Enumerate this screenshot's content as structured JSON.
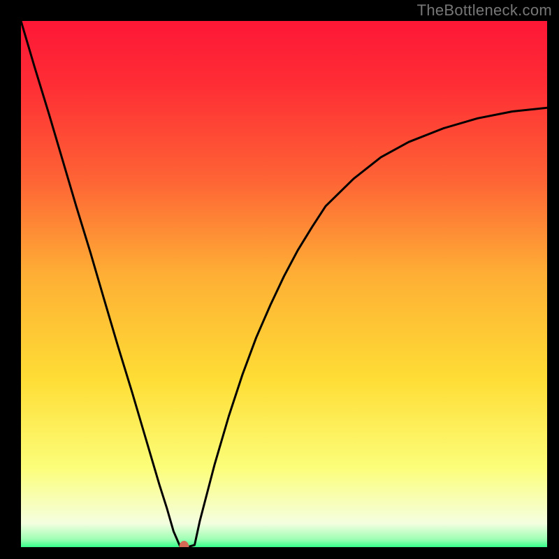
{
  "watermark": "TheBottleneck.com",
  "chart_data": {
    "type": "line",
    "title": "",
    "xlabel": "",
    "ylabel": "",
    "xlim": [
      0,
      100
    ],
    "ylim": [
      0,
      100
    ],
    "background_gradient": {
      "top": "#fe1736",
      "upper_mid": "#fe7b35",
      "mid": "#fedd35",
      "lower_mid": "#fbfeb4",
      "bottom": "#35fe8a"
    },
    "series": [
      {
        "name": "bottleneck-curve",
        "color": "#000000",
        "x": [
          0.0,
          2.6,
          5.3,
          7.9,
          10.5,
          13.2,
          15.8,
          18.4,
          21.1,
          23.7,
          26.3,
          27.7,
          29.0,
          30.3,
          31.6,
          33.0,
          34.0,
          36.8,
          39.5,
          42.1,
          44.7,
          47.4,
          50.0,
          52.6,
          55.3,
          57.9,
          63.2,
          68.4,
          73.7,
          80.3,
          86.8,
          93.4,
          100.0
        ],
        "y": [
          100.0,
          91.2,
          82.4,
          73.6,
          64.8,
          56.0,
          47.1,
          38.3,
          29.5,
          20.7,
          11.9,
          7.5,
          3.0,
          0.0,
          0.0,
          0.4,
          5.0,
          15.7,
          24.9,
          32.8,
          39.8,
          46.0,
          51.5,
          56.4,
          60.8,
          64.8,
          70.0,
          74.1,
          77.0,
          79.6,
          81.5,
          82.8,
          83.5
        ]
      }
    ],
    "marker": {
      "name": "optimal-point",
      "x": 31.0,
      "y": 0.0,
      "color": "#d46a56",
      "radius_px": 7
    }
  }
}
